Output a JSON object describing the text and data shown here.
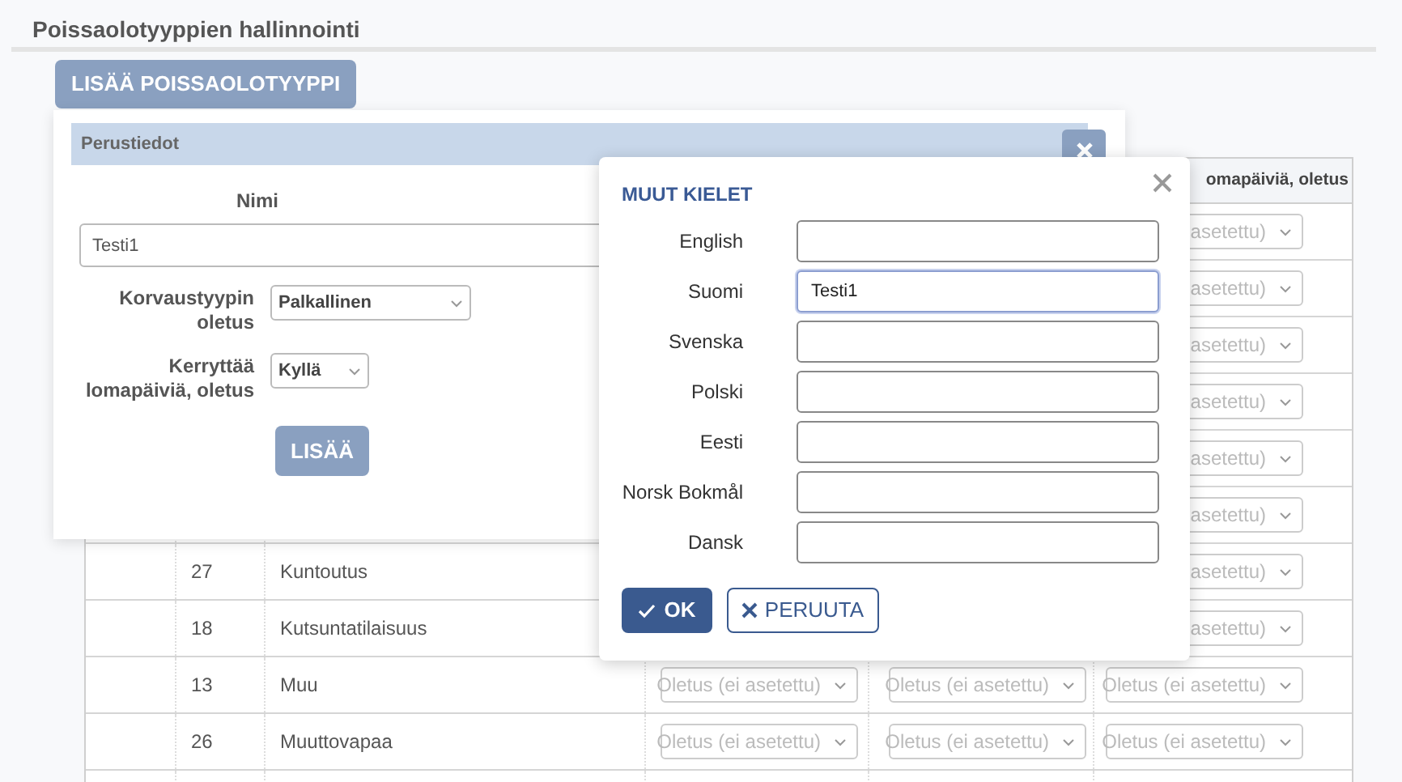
{
  "page": {
    "title": "Poissaolotyyppien hallinnointi",
    "add_button": "LISÄÄ POISSAOLOTYYPPI"
  },
  "table": {
    "header_column_6": "omapäiviä, oletus",
    "rows": [
      {
        "column_6": "asetettu)"
      },
      {
        "column_6": "asetettu)"
      },
      {
        "column_6": "asetettu)"
      },
      {
        "column_6": "asetettu)"
      },
      {
        "column_6": "asetettu)"
      },
      {
        "column_6": "asetettu)"
      },
      {
        "id": "27",
        "name": "Kuntoutus",
        "column_6": "asetettu)"
      },
      {
        "id": "18",
        "name": "Kutsuntatilaisuus",
        "column_6": "asetettu)"
      },
      {
        "id": "13",
        "name": "Muu",
        "column_4": "Oletus (ei asetettu)",
        "column_5": "Oletus (ei asetettu)",
        "column_6": "Oletus (ei asetettu)"
      },
      {
        "id": "26",
        "name": "Muuttovapaa",
        "column_4": "Oletus (ei asetettu)",
        "column_5": "Oletus (ei asetettu)",
        "column_6": "Oletus (ei asetettu)"
      },
      {}
    ]
  },
  "panel": {
    "header": "Perustiedot",
    "name_label": "Nimi",
    "name_value": "Testi1",
    "fields": [
      {
        "label": "Korvaustyypin oletus",
        "value": "Palkallinen"
      },
      {
        "label": "Kerryttää lomapäiviä, oletus",
        "value": "Kyllä"
      }
    ],
    "submit": "LISÄÄ"
  },
  "dialog": {
    "title": "MUUT KIELET",
    "languages": [
      {
        "label": "English",
        "focused": false
      },
      {
        "label": "Suomi",
        "value": "Testi1",
        "focused": true
      },
      {
        "label": "Svenska",
        "focused": false
      },
      {
        "label": "Polski",
        "focused": false
      },
      {
        "label": "Eesti",
        "focused": false
      },
      {
        "label": "Norsk Bokmål",
        "focused": false
      },
      {
        "label": "Dansk",
        "focused": false
      }
    ],
    "ok": "OK",
    "cancel": "PERUUTA"
  }
}
